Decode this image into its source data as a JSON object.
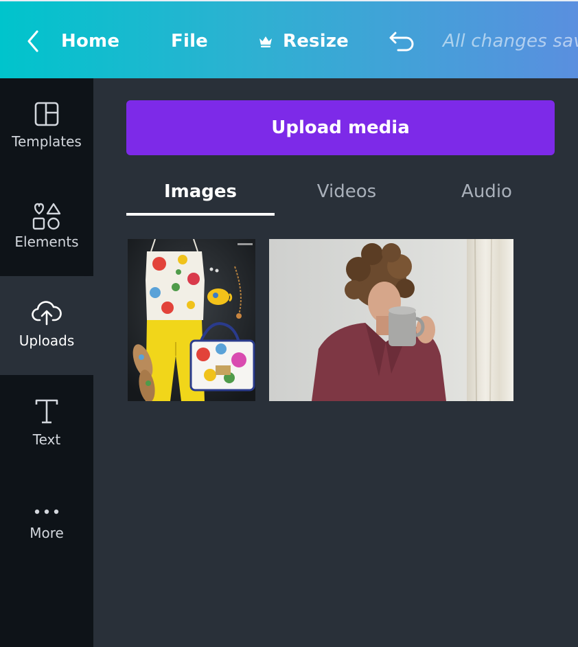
{
  "topbar": {
    "home_label": "Home",
    "file_label": "File",
    "resize_label": "Resize",
    "status_text": "All changes sav",
    "icons": {
      "back": "chevron-left-icon",
      "crown": "crown-icon",
      "undo": "undo-icon"
    }
  },
  "sidebar": {
    "items": [
      {
        "label": "Templates",
        "icon": "templates-icon",
        "active": false
      },
      {
        "label": "Elements",
        "icon": "shapes-icon",
        "active": false
      },
      {
        "label": "Uploads",
        "icon": "cloud-upload-icon",
        "active": true
      },
      {
        "label": "Text",
        "icon": "text-icon",
        "active": false
      },
      {
        "label": "More",
        "icon": "more-dots-icon",
        "active": false
      }
    ]
  },
  "uploads": {
    "upload_button_label": "Upload media",
    "tabs": [
      {
        "label": "Images",
        "active": true
      },
      {
        "label": "Videos",
        "active": false
      },
      {
        "label": "Audio",
        "active": false
      }
    ],
    "media": [
      {
        "kind": "image",
        "subject": "flat-lay outfit photo"
      },
      {
        "kind": "image",
        "subject": "woman drinking from mug photo"
      }
    ]
  },
  "colors": {
    "accent_purple": "#7d2ae8",
    "gradient_start": "#00c4cc",
    "gradient_end": "#5a8fdf",
    "panel_bg": "#293039",
    "rail_bg": "#0e1318"
  }
}
